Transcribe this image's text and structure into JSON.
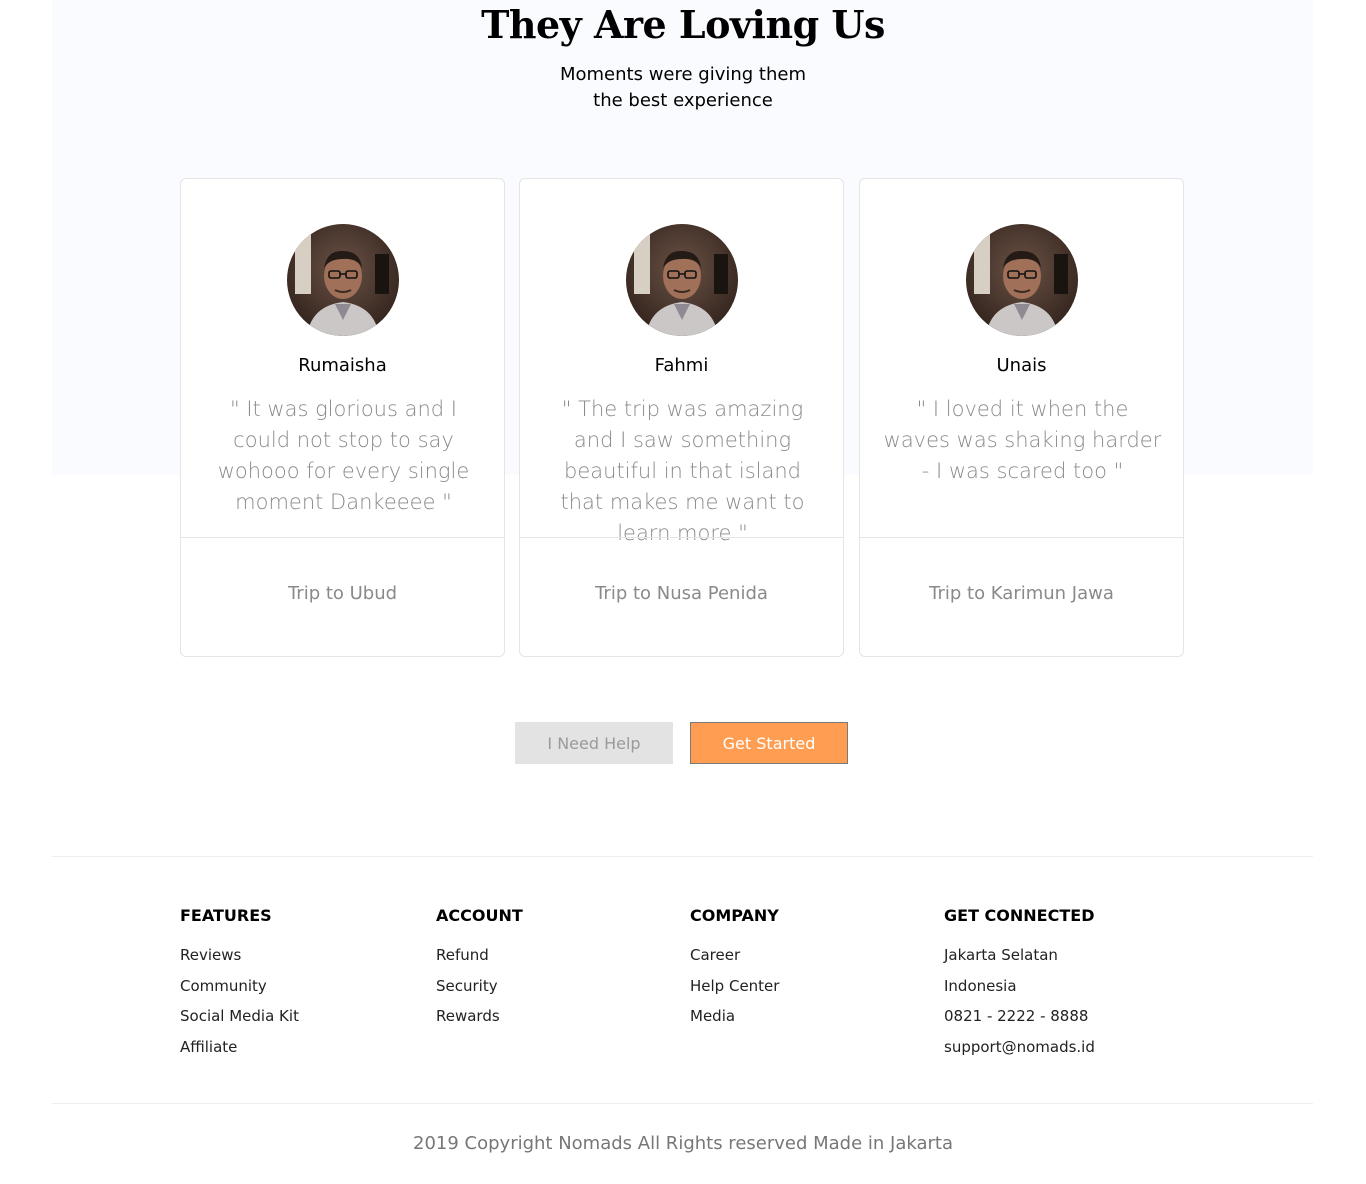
{
  "testimonials": {
    "title": "They Are Loving Us",
    "subtitle_line1": "Moments were giving them",
    "subtitle_line2": "the best experience",
    "cards": [
      {
        "name": "Rumaisha",
        "quote": "\" It was glorious and I could not stop to say wohooo for every single moment Dankeeee \"",
        "trip": "Trip to Ubud"
      },
      {
        "name": "Fahmi",
        "quote": "\" The trip was amazing and I saw something beautiful in that island that makes me want to learn more \"",
        "trip": "Trip to Nusa Penida"
      },
      {
        "name": "Unais",
        "quote": "\" I loved it when the waves was shaking harder - I was scared too \"",
        "trip": "Trip to Karimun Jawa"
      }
    ]
  },
  "actions": {
    "help_label": "I Need Help",
    "start_label": "Get Started"
  },
  "footer": {
    "columns": [
      {
        "heading": "FEATURES",
        "links": [
          "Reviews",
          "Community",
          "Social Media Kit",
          "Affiliate"
        ]
      },
      {
        "heading": "ACCOUNT",
        "links": [
          "Refund",
          "Security",
          "Rewards"
        ]
      },
      {
        "heading": "COMPANY",
        "links": [
          "Career",
          "Help Center",
          "Media"
        ]
      },
      {
        "heading": "GET CONNECTED",
        "links": [
          "Jakarta Selatan",
          "Indonesia",
          "0821 - 2222 - 8888",
          "support@nomads.id"
        ]
      }
    ],
    "copyright": "2019 Copyright Nomads All Rights reserved Made in Jakarta"
  },
  "colors": {
    "accent": "#ff9e53",
    "hero_background": "#fafbff",
    "muted_text": "#8a8a8a"
  },
  "icons": {
    "avatar": "user-photo-avatar"
  }
}
